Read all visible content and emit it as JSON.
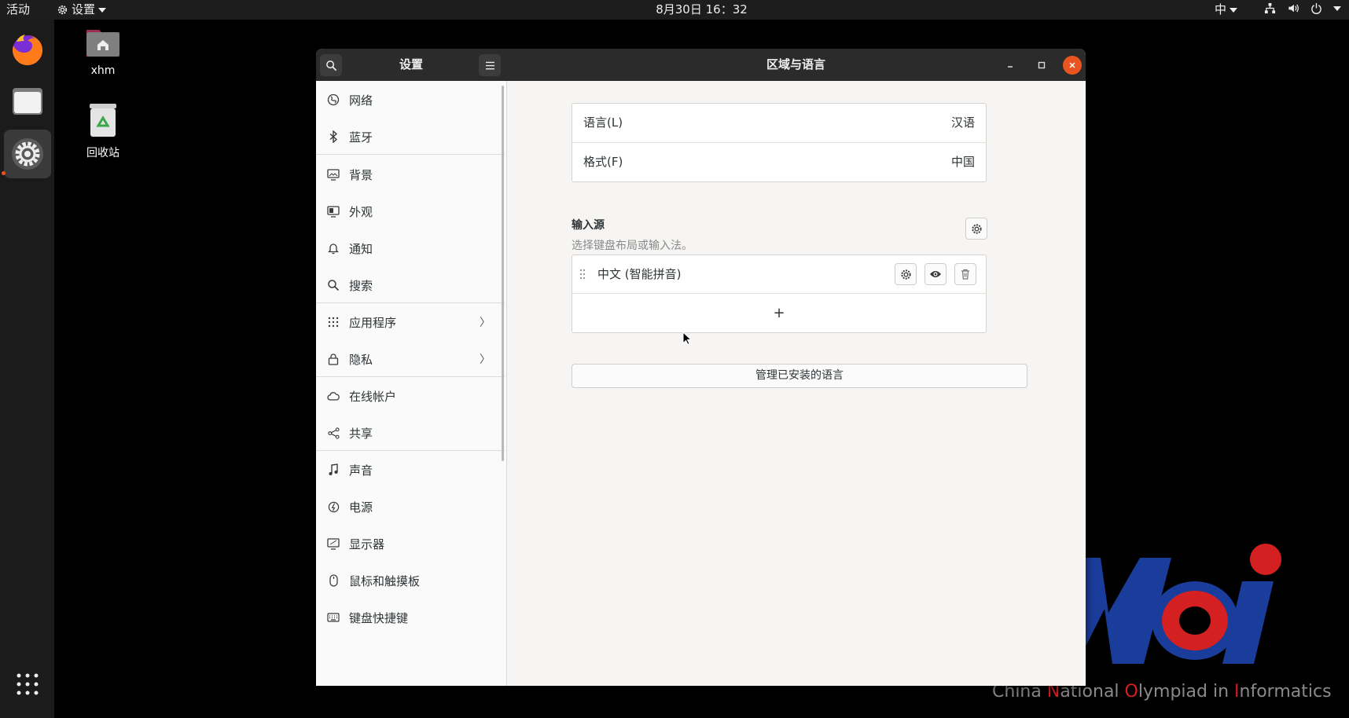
{
  "topbar": {
    "activities": "活动",
    "app_menu": "设置",
    "clock": "8月30日  16：32",
    "input_method": "中"
  },
  "desktop": {
    "home_label": "xhm",
    "trash_label": "回收站"
  },
  "watermark": {
    "caption_c": "C",
    "caption_1": "hina ",
    "caption_n": "N",
    "caption_2": "ational ",
    "caption_o": "O",
    "caption_3": "lympiad in ",
    "caption_i": "I",
    "caption_4": "nformatics"
  },
  "window": {
    "sidebar_title": "设置",
    "page_title": "区域与语言"
  },
  "sidebar": {
    "items": [
      {
        "label": "网络",
        "icon": "network-icon"
      },
      {
        "label": "蓝牙",
        "icon": "bluetooth-icon"
      },
      {
        "label": "背景",
        "icon": "background-icon"
      },
      {
        "label": "外观",
        "icon": "appearance-icon"
      },
      {
        "label": "通知",
        "icon": "bell-icon"
      },
      {
        "label": "搜索",
        "icon": "search-icon"
      },
      {
        "label": "应用程序",
        "icon": "apps-icon"
      },
      {
        "label": "隐私",
        "icon": "lock-icon"
      },
      {
        "label": "在线帐户",
        "icon": "cloud-icon"
      },
      {
        "label": "共享",
        "icon": "share-icon"
      },
      {
        "label": "声音",
        "icon": "music-icon"
      },
      {
        "label": "电源",
        "icon": "power-icon"
      },
      {
        "label": "显示器",
        "icon": "display-icon"
      },
      {
        "label": "鼠标和触摸板",
        "icon": "mouse-icon"
      },
      {
        "label": "键盘快捷键",
        "icon": "keyboard-icon"
      }
    ]
  },
  "region": {
    "language_label": "语言(L)",
    "language_value": "汉语",
    "formats_label": "格式(F)",
    "formats_value": "中国"
  },
  "input_sources": {
    "title": "输入源",
    "subtitle": "选择键盘布局或输入法。",
    "items": [
      {
        "name": "中文 (智能拼音)"
      }
    ],
    "add_label": "+",
    "manage_button": "管理已安装的语言"
  },
  "colors": {
    "accent": "#e95420",
    "headerbar": "#2b2b2b",
    "noi_blue": "#1a3d9c",
    "noi_red": "#d42020"
  }
}
